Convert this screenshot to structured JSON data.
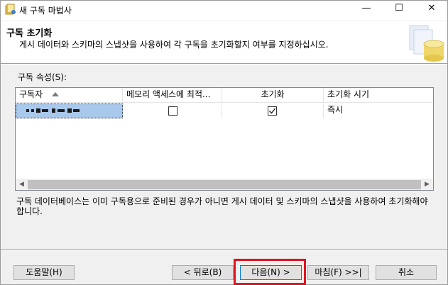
{
  "window": {
    "title": "새 구독 마법사",
    "minimize_glyph": "—",
    "maximize_glyph": "☐",
    "close_glyph": "✕"
  },
  "header": {
    "title": "구독 초기화",
    "subtitle": "게시 데이터와 스키마의 스냅샷을 사용하여 각 구독을 초기화할지 여부를 지정하십시오."
  },
  "properties_label": "구독 속성(S):",
  "grid": {
    "columns": [
      "구독자",
      "메모리 액세스에 최적...",
      "초기화",
      "초기화 시기"
    ],
    "rows": [
      {
        "subscriber": "",
        "memory_optimized": false,
        "initialize": true,
        "initialize_when": "즉시"
      }
    ],
    "scroll_left_glyph": "◀",
    "scroll_right_glyph": "▶"
  },
  "description": "구독 데이터베이스는 이미 구독용으로 준비된 경우가 아니면 게시 데이터 및 스키마의 스냅샷을 사용하여 초기화해야 합니다.",
  "buttons": {
    "help": "도움말(H)",
    "back": "< 뒤로(B)",
    "next": "다음(N) >",
    "finish": "마침(F) >>|",
    "cancel": "취소"
  },
  "icons": {
    "app": "wizard-icon",
    "header_graphic": "database-graphic",
    "sort": "sort-ascending-icon"
  },
  "colors": {
    "selection": "#a8c8ec",
    "highlight_box": "#e0141e",
    "default_button_border": "#0078d7"
  }
}
